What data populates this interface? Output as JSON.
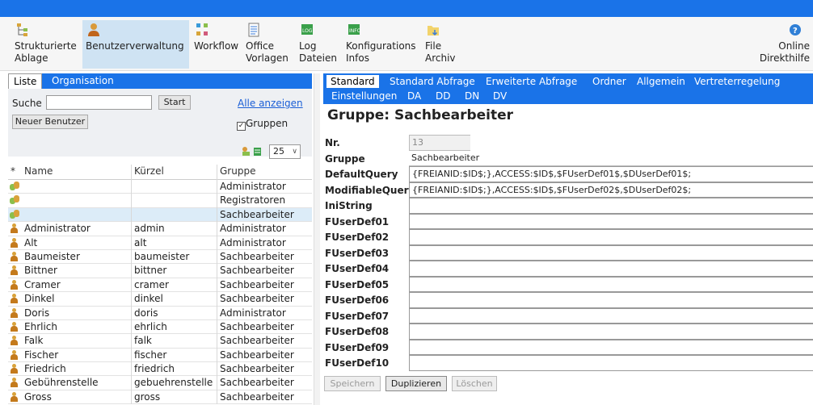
{
  "toolbar": {
    "items": [
      {
        "label": "Strukturierte\nAblage",
        "icon": "tree-icon"
      },
      {
        "label": "Benutzerverwaltung",
        "icon": "user-icon"
      },
      {
        "label": "Workflow",
        "icon": "workflow-icon"
      },
      {
        "label": "Office\nVorlagen",
        "icon": "document-icon"
      },
      {
        "label": "Log\nDateien",
        "icon": "log-icon"
      },
      {
        "label": "Konfigurations\nInfos",
        "icon": "info-icon"
      },
      {
        "label": "File\nArchiv",
        "icon": "folder-icon"
      },
      {
        "label": "Online\nDirekthilfe",
        "icon": "help-icon"
      }
    ]
  },
  "left": {
    "tabs": [
      "Liste",
      "Organisation"
    ],
    "search_label": "Suche",
    "search_value": "",
    "start_label": "Start",
    "show_all_label": "Alle anzeigen",
    "new_user_label": "Neuer Benutzer",
    "groups_label": "Gruppen",
    "page_size": "25",
    "columns": [
      "*",
      "Name",
      "Kürzel",
      "Gruppe"
    ],
    "rows": [
      {
        "type": "group",
        "name": "",
        "short": "",
        "group": "Administrator"
      },
      {
        "type": "group",
        "name": "",
        "short": "",
        "group": "Registratoren"
      },
      {
        "type": "group",
        "name": "",
        "short": "",
        "group": "Sachbearbeiter"
      },
      {
        "type": "user",
        "name": "Administrator",
        "short": "admin",
        "group": "Administrator"
      },
      {
        "type": "user",
        "name": "Alt",
        "short": "alt",
        "group": "Administrator"
      },
      {
        "type": "user",
        "name": "Baumeister",
        "short": "baumeister",
        "group": "Sachbearbeiter"
      },
      {
        "type": "user",
        "name": "Bittner",
        "short": "bittner",
        "group": "Sachbearbeiter"
      },
      {
        "type": "user",
        "name": "Cramer",
        "short": "cramer",
        "group": "Sachbearbeiter"
      },
      {
        "type": "user",
        "name": "Dinkel",
        "short": "dinkel",
        "group": "Sachbearbeiter"
      },
      {
        "type": "user",
        "name": "Doris",
        "short": "doris",
        "group": "Administrator"
      },
      {
        "type": "user",
        "name": "Ehrlich",
        "short": "ehrlich",
        "group": "Sachbearbeiter"
      },
      {
        "type": "user",
        "name": "Falk",
        "short": "falk",
        "group": "Sachbearbeiter"
      },
      {
        "type": "user",
        "name": "Fischer",
        "short": "fischer",
        "group": "Sachbearbeiter"
      },
      {
        "type": "user",
        "name": "Friedrich",
        "short": "friedrich",
        "group": "Sachbearbeiter"
      },
      {
        "type": "user",
        "name": "Gebührenstelle",
        "short": "gebuehrenstelle",
        "group": "Sachbearbeiter"
      },
      {
        "type": "user",
        "name": "Gross",
        "short": "gross",
        "group": "Sachbearbeiter"
      }
    ]
  },
  "right": {
    "tabs_row1": [
      "Standard",
      "Standard Abfrage",
      "Erweiterte Abfrage",
      "Ordner",
      "Allgemein",
      "Vertreterregelung"
    ],
    "tabs_row2": [
      "Einstellungen",
      "DA",
      "DD",
      "DN",
      "DV"
    ],
    "title": "Gruppe: Sachbearbeiter",
    "fields": [
      {
        "label": "Nr.",
        "value": "13"
      },
      {
        "label": "Gruppe",
        "value": "Sachbearbeiter"
      },
      {
        "label": "DefaultQuery",
        "value": "{FREIANID:$ID$;},ACCESS:$ID$,$FUserDef01$,$DUserDef01$;"
      },
      {
        "label": "ModifiableQuery",
        "value": "{FREIANID:$ID$;},ACCESS:$ID$,$FUserDef02$,$DUserDef02$;"
      },
      {
        "label": "IniString",
        "value": ""
      },
      {
        "label": "FUserDef01",
        "value": ""
      },
      {
        "label": "FUserDef02",
        "value": ""
      },
      {
        "label": "FUserDef03",
        "value": ""
      },
      {
        "label": "FUserDef04",
        "value": ""
      },
      {
        "label": "FUserDef05",
        "value": ""
      },
      {
        "label": "FUserDef06",
        "value": ""
      },
      {
        "label": "FUserDef07",
        "value": ""
      },
      {
        "label": "FUserDef08",
        "value": ""
      },
      {
        "label": "FUserDef09",
        "value": ""
      },
      {
        "label": "FUserDef10",
        "value": ""
      }
    ],
    "buttons": [
      "Speichern",
      "Duplizieren",
      "Löschen"
    ]
  },
  "colors": {
    "accent": "#1a73e8",
    "link": "#1a5ed6",
    "highlight": "#dcecf8"
  }
}
